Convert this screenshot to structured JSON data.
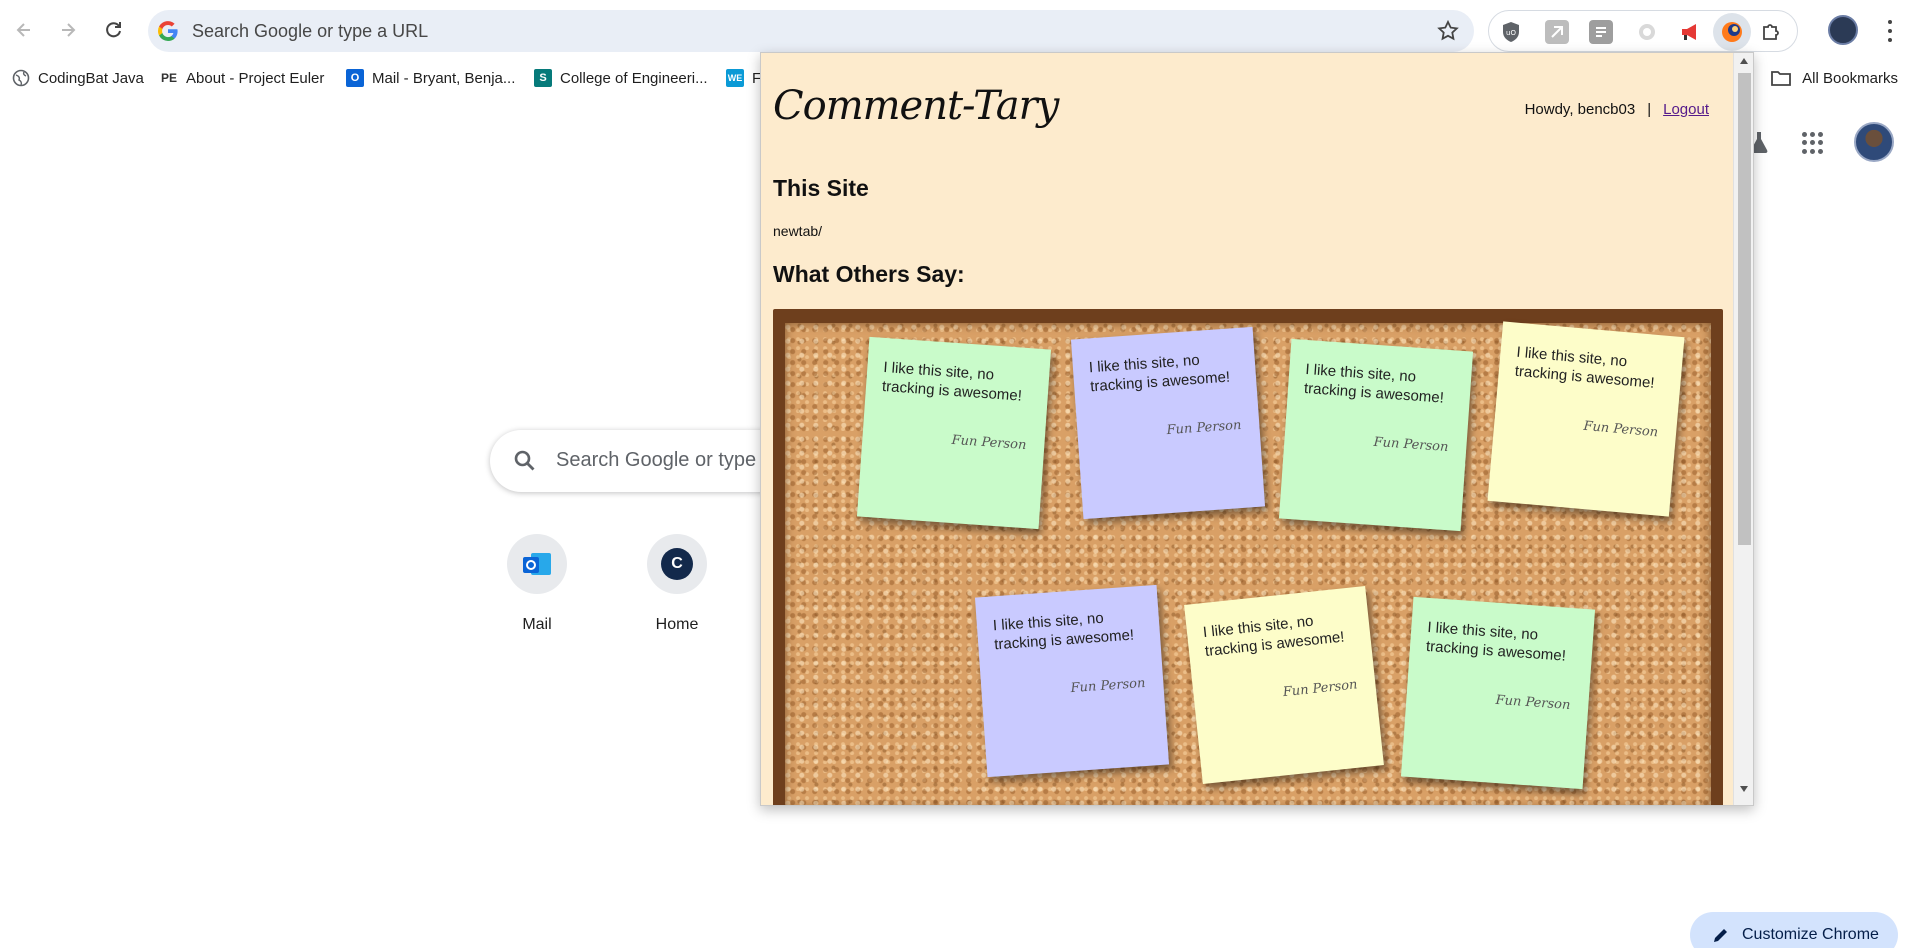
{
  "browser": {
    "omnibox_placeholder": "Search Google or type a URL",
    "extensions": [
      "ublock-origin-icon",
      "extension-icon",
      "extension-icon",
      "extension-icon",
      "megaphone-icon",
      "comment-tary-icon",
      "puzzle-icon"
    ]
  },
  "bookmarks": {
    "items": [
      {
        "label": "CodingBat Java",
        "icon": "globe-icon"
      },
      {
        "label": "About - Project Euler",
        "icon": "project-euler-icon"
      },
      {
        "label": "Mail - Bryant, Benja...",
        "icon": "outlook-icon"
      },
      {
        "label": "College of Engineeri...",
        "icon": "sharepoint-icon"
      },
      {
        "label": "F",
        "icon": "we-icon"
      }
    ],
    "all_label": "All Bookmarks"
  },
  "ntp": {
    "search_placeholder": "Search Google or type a",
    "shortcuts": [
      {
        "label": "Mail",
        "icon": "outlook-icon"
      },
      {
        "label": "Home",
        "letter": "C"
      }
    ],
    "customize_label": "Customize Chrome"
  },
  "popup": {
    "logo": "Comment-Tary",
    "greeting": "Howdy, bencb03",
    "separator": "|",
    "logout_label": "Logout",
    "this_site_heading": "This Site",
    "site_url": "newtab/",
    "others_heading": "What Others Say:",
    "notes": [
      {
        "text": "I like this site, no tracking is awesome!",
        "author": "Fun Person",
        "color": "green"
      },
      {
        "text": "I like this site, no tracking is awesome!",
        "author": "Fun Person",
        "color": "blue"
      },
      {
        "text": "I like this site, no tracking is awesome!",
        "author": "Fun Person",
        "color": "green"
      },
      {
        "text": "I like this site, no tracking is awesome!",
        "author": "Fun Person",
        "color": "yellow"
      },
      {
        "text": "I like this site, no tracking is awesome!",
        "author": "Fun Person",
        "color": "blue"
      },
      {
        "text": "I like this site, no tracking is awesome!",
        "author": "Fun Person",
        "color": "yellow"
      },
      {
        "text": "I like this site, no tracking is awesome!",
        "author": "Fun Person",
        "color": "green"
      }
    ],
    "colors": {
      "green": "#c9fbca",
      "blue": "#c9caff",
      "yellow": "#fdfdc9",
      "background": "#fdebcd"
    }
  }
}
